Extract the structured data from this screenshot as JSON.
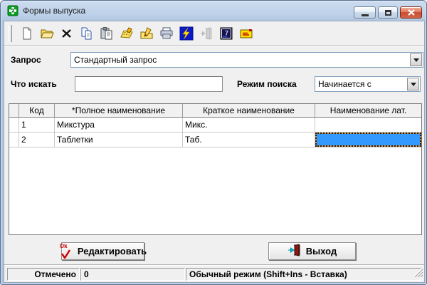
{
  "window": {
    "title": "Формы выпуска",
    "controls": [
      "minimize",
      "maximize",
      "close"
    ]
  },
  "toolbar": {
    "buttons": [
      {
        "icon": "new-document-icon",
        "enabled": true
      },
      {
        "icon": "open-folder-icon",
        "enabled": true
      },
      {
        "icon": "delete-x-icon",
        "enabled": true
      },
      {
        "icon": "copy-icon",
        "enabled": true
      },
      {
        "icon": "paste-icon",
        "enabled": true
      },
      {
        "icon": "edit-note-icon",
        "enabled": true
      },
      {
        "icon": "edit-folder-icon",
        "enabled": true
      },
      {
        "icon": "printer-icon",
        "enabled": true
      },
      {
        "icon": "lightning-icon",
        "enabled": true
      },
      {
        "icon": "exit-door-icon",
        "enabled": false
      },
      {
        "icon": "calculator-icon",
        "enabled": true
      },
      {
        "icon": "mail-envelope-icon",
        "enabled": true
      }
    ]
  },
  "filters": {
    "query_label": "Запрос",
    "query_value": "Стандартный запрос",
    "search_label": "Что искать",
    "search_value": "",
    "mode_label": "Режим поиска",
    "mode_value": "Начинается с"
  },
  "table": {
    "columns": [
      "",
      "Код",
      "*Полное наименование",
      "Краткое наименование",
      "Наименование лат."
    ],
    "rows": [
      {
        "code": "1",
        "full": "Микстура",
        "short": "Микс.",
        "lat": ""
      },
      {
        "code": "2",
        "full": "Таблетки",
        "short": "Таб.",
        "lat": ""
      }
    ],
    "selected_cell": {
      "row_index": 1,
      "column": "Наименование лат."
    }
  },
  "buttons": {
    "edit_label": "Редактировать",
    "edit_icon_text": "Ok",
    "exit_label": "Выход"
  },
  "statusbar": {
    "marked_label": "Отмечено",
    "marked_value": "0",
    "mode_text": "Обычный режим (Shift+Ins - Вставка)"
  },
  "colors": {
    "selection": "#3399ff",
    "selection_border": "#cf8e3c",
    "titlebar_top": "#cddcf0",
    "titlebar_bottom": "#abc2de",
    "close_button": "#c74b31",
    "lightning_blue": "#0b18c8",
    "content_bg": "#f0f0f0"
  }
}
